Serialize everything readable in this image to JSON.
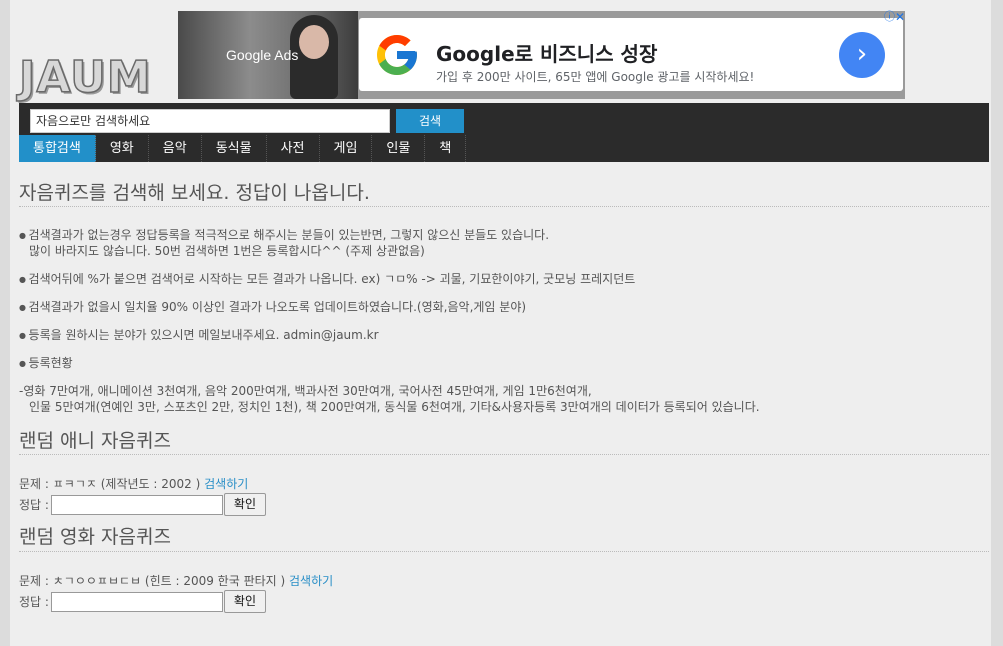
{
  "site": {
    "logo_text": "JAUM"
  },
  "ad": {
    "brand": "Google Ads",
    "title": "Google로 비즈니스 성장",
    "subtitle": "가입 후 200만 사이트, 65만 앱에 Google 광고를 시작하세요!",
    "info_icon": "ⓘ",
    "close_icon": "✕",
    "arrow_icon": "›",
    "colors": {
      "arrow": "#4285f4"
    }
  },
  "search": {
    "value": "자음으로만 검색하세요",
    "button_label": "검색"
  },
  "nav": {
    "items": [
      {
        "label": "통합검색",
        "active": true
      },
      {
        "label": "영화"
      },
      {
        "label": "음악"
      },
      {
        "label": "동식물"
      },
      {
        "label": "사전"
      },
      {
        "label": "게임"
      },
      {
        "label": "인물"
      },
      {
        "label": "책"
      }
    ]
  },
  "main": {
    "headline": "자음퀴즈를 검색해 보세요. 정답이 나옵니다.",
    "notes": [
      "검색결과가 없는경우 정답등록을 적극적으로 해주시는 분들이 있는반면, 그렇지 않으신 분들도 있습니다.",
      "많이 바라지도 않습니다. 50번 검색하면 1번은 등록합시다^^ (주제 상관없음)",
      "검색어뒤에 %가 붙으면 검색어로 시작하는 모든 결과가 나옵니다. ex) ㄱㅁ% -> 괴물, 기묘한이야기, 굿모닝 프레지던트",
      "검색결과가 없을시 일치율 90% 이상인 결과가 나오도록 업데이트하였습니다.(영화,음악,게임 분야)",
      "등록을 원하시는 분야가 있으시면 메일보내주세요. admin@jaum.kr",
      "등록현황"
    ],
    "stats_line1": "-영화 7만여개, 애니메이션 3천여개, 음악 200만여개, 백과사전 30만여개, 국어사전 45만여개, 게임 1만6천여개,",
    "stats_line2": "인물 5만여개(연예인 3만, 스포츠인 2만, 정치인 1천), 책 200만여개, 동식물 6천여개, 기타&사용자등록 3만여개의 데이터가 등록되어 있습니다."
  },
  "quiz_anime": {
    "title": "랜덤 애니 자음퀴즈",
    "question": "문제 : ㅍㅋㄱㅈ (제작년도 : 2002 )",
    "search_link": "검색하기",
    "answer_label": "정답 :",
    "confirm_label": "확인"
  },
  "quiz_movie": {
    "title": "랜덤 영화 자음퀴즈",
    "question": "문제 : ㅊㄱㅇㅇㅍㅂㄷㅂ (힌트 : 2009 한국 판타지 )",
    "search_link": "검색하기",
    "answer_label": "정답 :",
    "confirm_label": "확인"
  }
}
